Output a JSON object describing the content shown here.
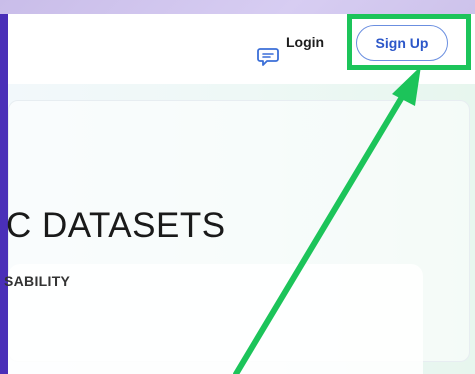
{
  "header": {
    "login_label": "Login",
    "signup_label": "Sign Up",
    "feedback_icon": "chat-bubble-icon"
  },
  "hero": {
    "title": "C DATASETS",
    "subtitle": "SABILITY"
  },
  "annotation": {
    "highlight_color": "#1cc45a",
    "arrow_color": "#1cc45a",
    "target": "Sign Up"
  },
  "colors": {
    "accent": "#2c57c9",
    "frame": "#4a2fb8"
  }
}
